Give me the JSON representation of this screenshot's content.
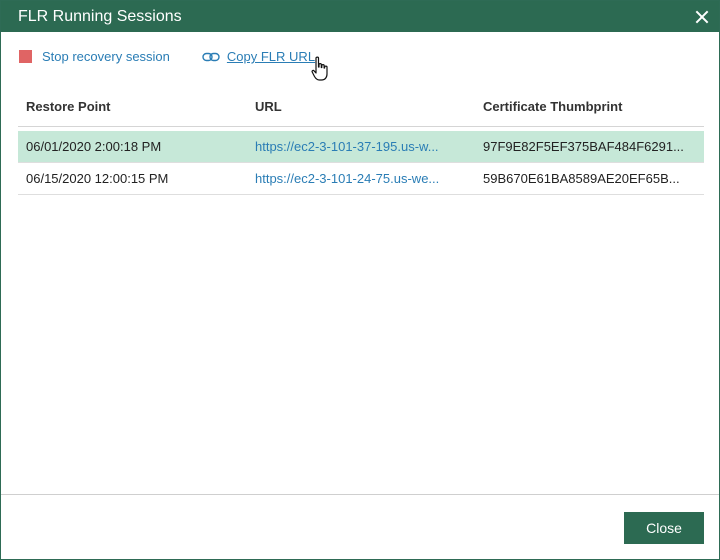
{
  "dialog": {
    "title": "FLR Running Sessions",
    "close_icon": "close-icon"
  },
  "toolbar": {
    "stop_label": "Stop recovery session",
    "copy_label": "Copy FLR URL"
  },
  "table": {
    "columns": [
      "Restore Point",
      "URL",
      "Certificate Thumbprint"
    ],
    "rows": [
      {
        "restore_point": "06/01/2020 2:00:18 PM",
        "url": "https://ec2-3-101-37-195.us-w...",
        "thumbprint": "97F9E82F5EF375BAF484F6291..."
      },
      {
        "restore_point": "06/15/2020 12:00:15 PM",
        "url": "https://ec2-3-101-24-75.us-we...",
        "thumbprint": "59B670E61BA8589AE20EF65B..."
      }
    ],
    "selected_row": 0
  },
  "footer": {
    "close_label": "Close"
  },
  "colors": {
    "title_bar": "#2c6a52",
    "selected_row": "#c6e8d8",
    "link": "#2a7db5",
    "stop_icon": "#e06464"
  }
}
